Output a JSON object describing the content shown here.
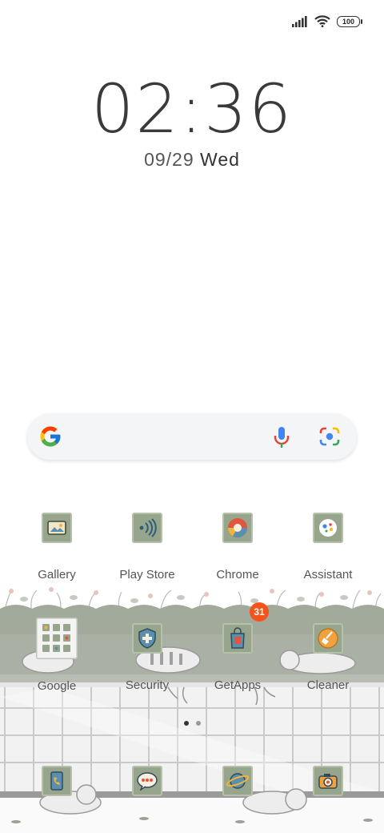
{
  "status_bar": {
    "battery_level": "100",
    "signal_icon": "signal-bars-icon",
    "wifi_icon": "wifi-icon"
  },
  "clock": {
    "time": "02:36",
    "date": "09/29",
    "weekday": "Wed"
  },
  "search_bar": {
    "logo_icon": "google-g-icon",
    "mic_icon": "microphone-icon",
    "lens_icon": "camera-lens-icon"
  },
  "apps_row1": [
    {
      "label": "Gallery",
      "icon": "gallery-icon"
    },
    {
      "label": "Play Store",
      "icon": "play-store-icon"
    },
    {
      "label": "Chrome",
      "icon": "chrome-icon"
    },
    {
      "label": "Assistant",
      "icon": "assistant-icon"
    }
  ],
  "apps_row2": [
    {
      "label": "Google",
      "icon": "google-folder-icon"
    },
    {
      "label": "Security",
      "icon": "security-icon"
    },
    {
      "label": "GetApps",
      "icon": "getapps-icon",
      "badge": "31"
    },
    {
      "label": "Cleaner",
      "icon": "cleaner-icon"
    }
  ],
  "page_indicator": {
    "pages": 2,
    "active": 1
  },
  "dock": [
    {
      "icon": "phone-icon"
    },
    {
      "icon": "messages-icon"
    },
    {
      "icon": "browser-icon"
    },
    {
      "icon": "camera-icon"
    }
  ],
  "colors": {
    "tile": "#96a58b",
    "badge": "#f2541b",
    "text": "#555555"
  }
}
